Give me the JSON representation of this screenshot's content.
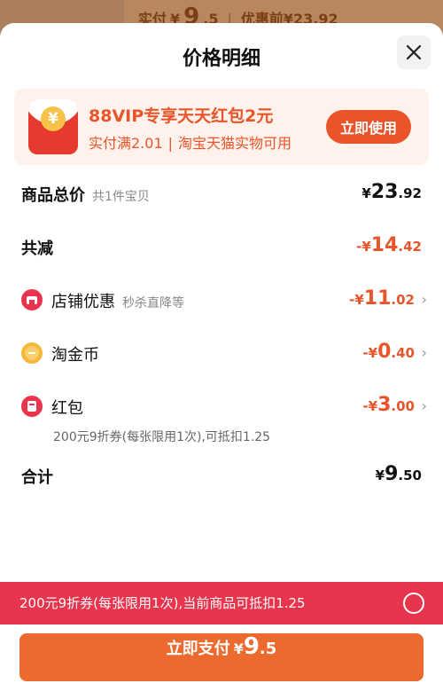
{
  "backdrop": {
    "paid_label": "实付",
    "paid_currency": "¥",
    "paid_int": "9",
    "paid_dec": ".5",
    "separator": "|",
    "before_discount": "优惠前¥23.92"
  },
  "sheet": {
    "title": "价格明细"
  },
  "promo": {
    "title": "88VIP专享天天红包2元",
    "condition": "实付满2.01",
    "separator": "|",
    "scope": "淘宝天猫实物可用",
    "button_label": "立即使用"
  },
  "rows": {
    "total": {
      "label": "商品总价",
      "hint": "共1件宝贝",
      "currency": "¥",
      "int": "23",
      "dec": ".92"
    },
    "reduction": {
      "label": "共减",
      "currency": "-¥",
      "int": "14",
      "dec": ".42"
    },
    "store": {
      "label": "店铺优惠",
      "hint": "秒杀直降等",
      "currency": "-¥",
      "int": "11",
      "dec": ".02",
      "arrow": "›"
    },
    "coins": {
      "label": "淘金币",
      "currency": "-¥",
      "int": "0",
      "dec": ".40",
      "arrow": "›"
    },
    "redpacket": {
      "label": "红包",
      "currency": "-¥",
      "int": "3",
      "dec": ".00",
      "arrow": "›",
      "note": "200元9折券(每张限用1次),可抵扣1.25"
    },
    "sum": {
      "label": "合计",
      "currency": "¥",
      "int": "9",
      "dec": ".50"
    }
  },
  "notice": {
    "text": "200元9折券(每张限用1次),当前商品可抵扣1.25"
  },
  "pay": {
    "label": "立即支付",
    "currency": "¥",
    "int": "9",
    "dec": ".5"
  },
  "colors": {
    "accent_orange": "#e8552a",
    "notice_red": "#e8344c",
    "pay_orange": "#ec6a2d"
  },
  "icons": {
    "store": "store-icon",
    "coin": "coin-icon",
    "redpacket": "red-packet-icon",
    "close": "close-icon"
  }
}
